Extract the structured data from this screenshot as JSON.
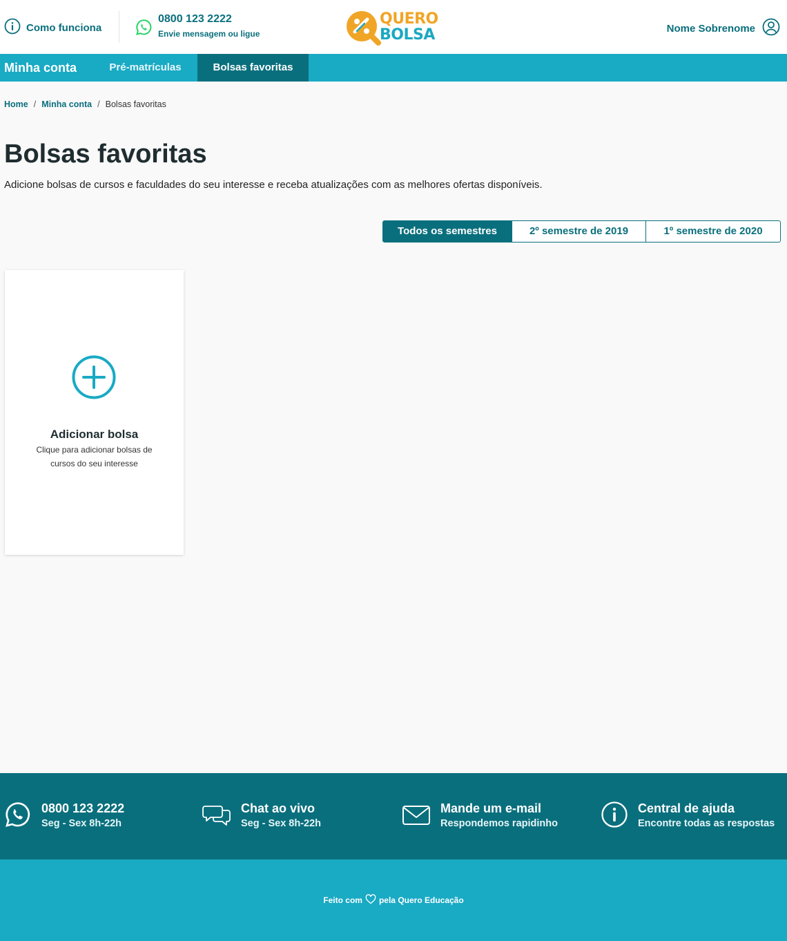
{
  "header": {
    "how_it_works": "Como funciona",
    "phone": "0800 123 2222",
    "phone_sub": "Envie mensagem ou ligue",
    "logo_line1": "QUERO",
    "logo_line2": "BOLSA",
    "user_name": "Nome Sobrenome"
  },
  "nav": {
    "title": "Minha conta",
    "tabs": [
      {
        "label": "Pré-matrículas",
        "active": false
      },
      {
        "label": "Bolsas favoritas",
        "active": true
      }
    ]
  },
  "breadcrumb": {
    "items": [
      "Home",
      "Minha conta"
    ],
    "current": "Bolsas favoritas",
    "separator": "/"
  },
  "page": {
    "title": "Bolsas favoritas",
    "description": "Adicione bolsas de cursos e faculdades do seu interesse e receba atualizações com as melhores ofertas disponíveis."
  },
  "filters": [
    {
      "label": "Todos os semestres",
      "active": true
    },
    {
      "label": "2º semestre de 2019",
      "active": false
    },
    {
      "label": "1º semestre de 2020",
      "active": false
    }
  ],
  "add_card": {
    "title": "Adicionar bolsa",
    "description": "Clique para adicionar bolsas de cursos do seu interesse"
  },
  "contact": [
    {
      "icon": "whatsapp-icon",
      "title": "0800 123 2222",
      "sub": "Seg - Sex 8h-22h"
    },
    {
      "icon": "chat-icon",
      "title": "Chat ao vivo",
      "sub": "Seg - Sex 8h-22h"
    },
    {
      "icon": "mail-icon",
      "title": "Mande um e-mail",
      "sub": "Respondemos rapidinho"
    },
    {
      "icon": "info-icon",
      "title": "Central de ajuda",
      "sub": "Encontre todas as respostas"
    }
  ],
  "footer": {
    "made_prefix": "Feito com",
    "made_suffix": "pela Quero Educação"
  },
  "colors": {
    "primary_dark": "#0a6f7d",
    "primary": "#19aac4",
    "logo_orange": "#f0a526",
    "whatsapp_green": "#25d366"
  }
}
